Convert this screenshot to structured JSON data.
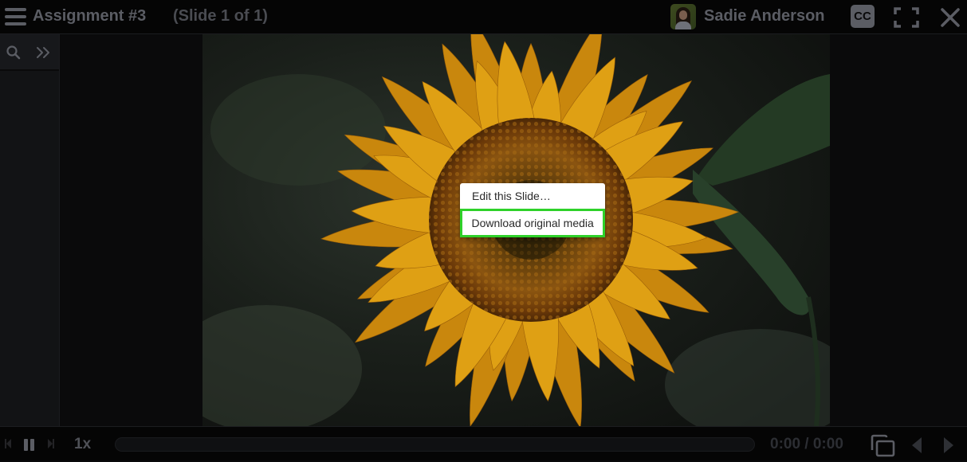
{
  "header": {
    "title": "Assignment #3",
    "slide_counter": "(Slide 1 of 1)",
    "user_name": "Sadie Anderson",
    "cc_label": "CC",
    "icons": {
      "menu": "hamburger-menu-icon",
      "avatar": "user-avatar",
      "captions": "closed-captions-icon",
      "fullscreen": "fullscreen-icon",
      "close": "close-x-icon"
    }
  },
  "sidebar": {
    "icons": {
      "search": "search-icon",
      "expand": "double-chevron-right-icon"
    }
  },
  "slide": {
    "media_description": "Sunflower photo, dimmed",
    "context_menu": {
      "items": [
        {
          "label": "Edit this Slide…",
          "highlighted": false
        },
        {
          "label": "Download original media",
          "highlighted": true
        }
      ],
      "highlight_color": "#2fd12a"
    }
  },
  "player": {
    "playback_state": "playing",
    "speed_label": "1x",
    "progress": 0,
    "time_display": "0:00 / 0:00",
    "icons": {
      "step_back": "step-back-icon",
      "pause": "pause-icon",
      "step_forward": "step-forward-icon",
      "picture_in_picture": "picture-in-picture-icon",
      "previous": "previous-slide-icon",
      "next": "next-slide-icon"
    }
  },
  "colors": {
    "chrome_bg": "#050505",
    "icon_gray": "#5b5d64",
    "menu_text": "#2a2a2a",
    "highlight": "#2fd12a"
  }
}
